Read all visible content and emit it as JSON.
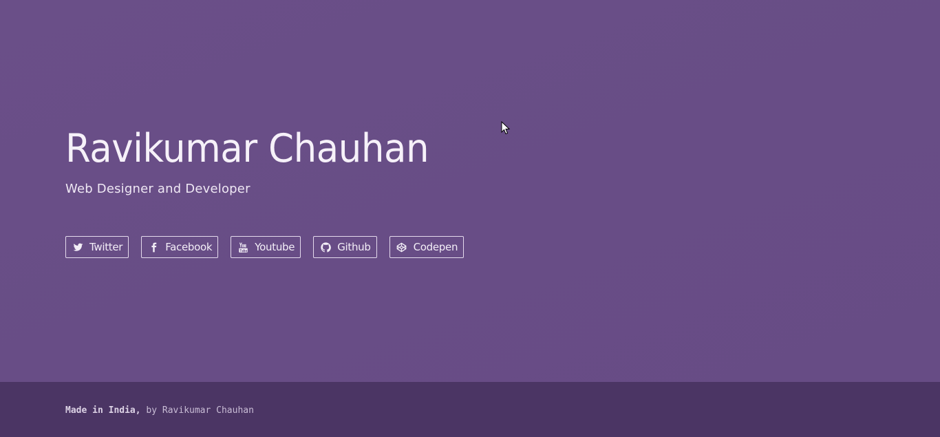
{
  "hero": {
    "name": "Ravikumar Chauhan",
    "tagline": "Web Designer and Developer"
  },
  "social": [
    {
      "label": "Twitter",
      "icon": "twitter-icon"
    },
    {
      "label": "Facebook",
      "icon": "facebook-icon"
    },
    {
      "label": "Youtube",
      "icon": "youtube-icon"
    },
    {
      "label": "Github",
      "icon": "github-icon"
    },
    {
      "label": "Codepen",
      "icon": "codepen-icon"
    }
  ],
  "footer": {
    "made_in": "Made in India,",
    "by": " by Ravikumar Chauhan"
  },
  "colors": {
    "background": "#684d86",
    "footer_background": "#4b3564",
    "text": "#f3eef7"
  }
}
